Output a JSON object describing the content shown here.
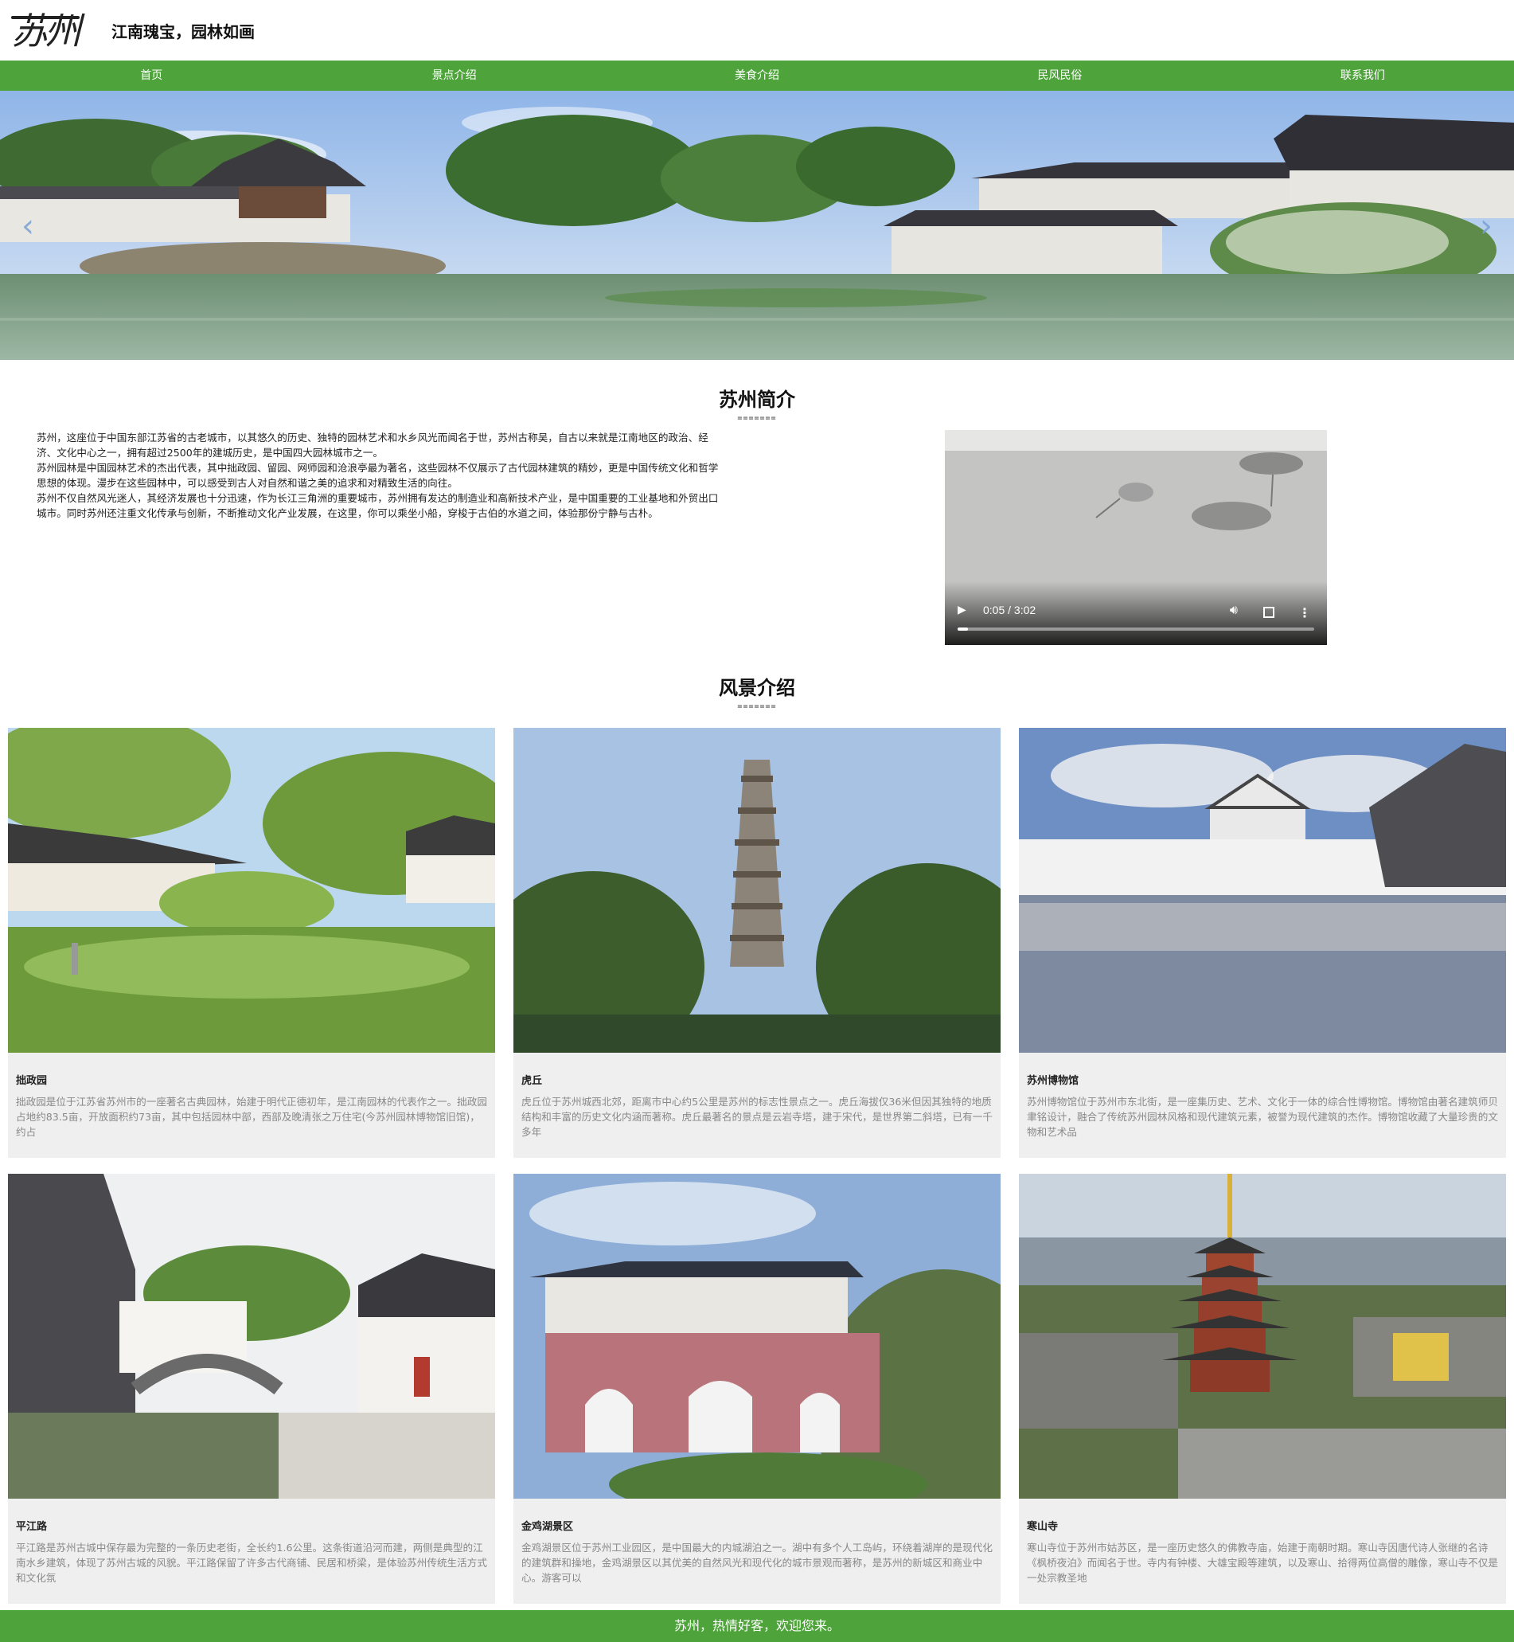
{
  "header": {
    "logo_text": "苏州",
    "slogan": "江南瑰宝，园林如画"
  },
  "nav": {
    "items": [
      {
        "label": "首页"
      },
      {
        "label": "景点介绍"
      },
      {
        "label": "美食介绍"
      },
      {
        "label": "民风民俗"
      },
      {
        "label": "联系我们"
      }
    ],
    "color": "#4ea43b"
  },
  "intro": {
    "title": "苏州简介",
    "underline": "=======",
    "paragraphs": [
      "苏州，这座位于中国东部江苏省的古老城市，以其悠久的历史、独特的园林艺术和水乡风光而闻名于世，苏州古称吴，自古以来就是江南地区的政治、经济、文化中心之一，拥有超过2500年的建城历史，是中国四大园林城市之一。",
      "苏州园林是中国园林艺术的杰出代表，其中拙政园、留园、网师园和沧浪亭最为著名，这些园林不仅展示了古代园林建筑的精妙，更是中国传统文化和哲学思想的体现。漫步在这些园林中，可以感受到古人对自然和谐之美的追求和对精致生活的向往。",
      "苏州不仅自然风光迷人，其经济发展也十分迅速，作为长江三角洲的重要城市，苏州拥有发达的制造业和高新技术产业，是中国重要的工业基地和外贸出口城市。同时苏州还注重文化传承与创新，不断推动文化产业发展，在这里，你可以乘坐小船，穿梭于古伯的水道之间，体验那份宁静与古朴。"
    ],
    "video": {
      "time": "0:05 / 3:02",
      "progress": 0.03,
      "play_icon": "play-icon",
      "volume_icon": "volume-icon",
      "fullscreen_icon": "fullscreen-icon",
      "menu_icon": "more-vert-icon"
    }
  },
  "scenery": {
    "title": "风景介绍",
    "underline": "=======",
    "cards": [
      {
        "title": "拙政园",
        "desc": "拙政园是位于江苏省苏州市的一座著名古典园林，始建于明代正德初年，是江南园林的代表作之一。拙政园占地约83.5亩，开放面积约73亩，其中包括园林中部，西部及晚清张之万住宅(今苏州园林博物馆旧馆)，约占"
      },
      {
        "title": "虎丘",
        "desc": "虎丘位于苏州城西北郊，距离市中心约5公里是苏州的标志性景点之一。虎丘海拔仅36米但因其独特的地质结构和丰富的历史文化内涵而著称。虎丘最著名的景点是云岩寺塔，建于宋代，是世界第二斜塔，已有一千多年"
      },
      {
        "title": "苏州博物馆",
        "desc": "苏州博物馆位于苏州市东北街，是一座集历史、艺术、文化于一体的综合性博物馆。博物馆由著名建筑师贝聿铭设计，融合了传统苏州园林风格和现代建筑元素，被誉为现代建筑的杰作。博物馆收藏了大量珍贵的文物和艺术品"
      },
      {
        "title": "平江路",
        "desc": "平江路是苏州古城中保存最为完整的一条历史老街，全长约1.6公里。这条街道沿河而建，两侧是典型的江南水乡建筑，体现了苏州古城的风貌。平江路保留了许多古代商铺、民居和桥梁，是体验苏州传统生活方式和文化氛"
      },
      {
        "title": "金鸡湖景区",
        "desc": "金鸡湖景区位于苏州工业园区，是中国最大的内城湖泊之一。湖中有多个人工岛屿，环绕着湖岸的是现代化的建筑群和操地，金鸡湖景区以其优美的自然风光和现代化的城市景观而著称，是苏州的新城区和商业中心。游客可以"
      },
      {
        "title": "寒山寺",
        "desc": "寒山寺位于苏州市姑苏区，是一座历史悠久的佛教寺庙，始建于南朝时期。寒山寺因唐代诗人张继的名诗《枫桥夜泊》而闻名于世。寺内有钟楼、大雄宝殿等建筑，以及寒山、拾得两位高僧的雕像，寒山寺不仅是一处宗教圣地"
      }
    ]
  },
  "footer": {
    "text": "苏州，热情好客，欢迎您来。"
  }
}
